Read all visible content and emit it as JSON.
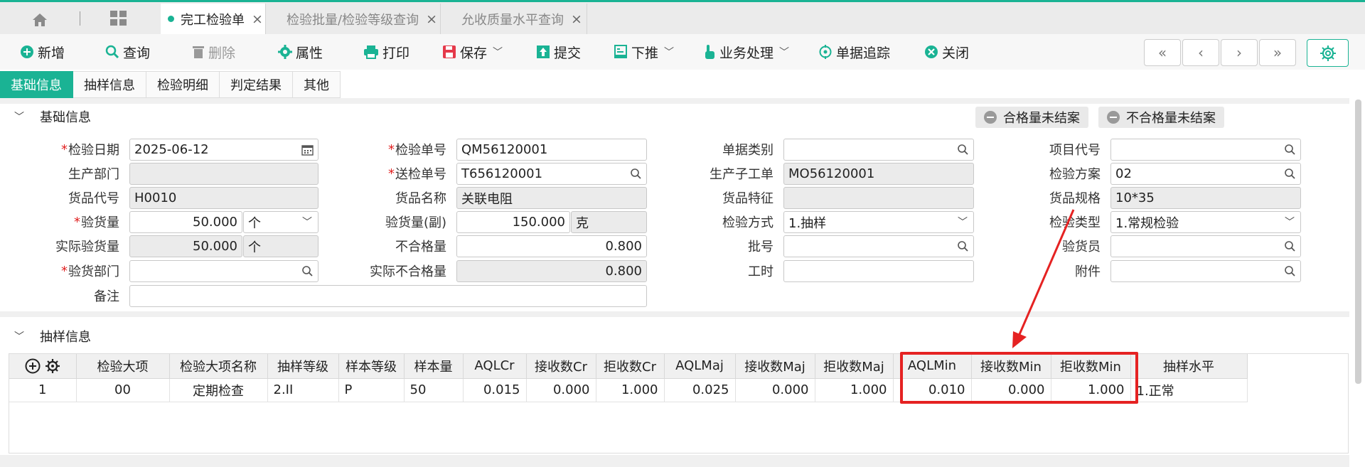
{
  "tabs": [
    {
      "label": "完工检验单",
      "close": "×"
    },
    {
      "label": "检验批量/检验等级查询",
      "close": "×"
    },
    {
      "label": "允收质量水平查询",
      "close": "×"
    }
  ],
  "toolbar": {
    "new": "新增",
    "query": "查询",
    "delete": "删除",
    "properties": "属性",
    "print": "打印",
    "save": "保存",
    "submit": "提交",
    "push_down": "下推",
    "business": "业务处理",
    "trace": "单据追踪",
    "close": "关闭"
  },
  "subtabs": [
    "基础信息",
    "抽样信息",
    "检验明细",
    "判定结果",
    "其他"
  ],
  "section_basic": {
    "title": "基础信息",
    "badge_pass": "合格量未结案",
    "badge_fail": "不合格量未结案"
  },
  "form": {
    "inspect_date": {
      "label": "检验日期",
      "value": "2025-06-12"
    },
    "prod_dept": {
      "label": "生产部门",
      "value": ""
    },
    "item_code": {
      "label": "货品代号",
      "value": "H0010"
    },
    "inspect_qty": {
      "label": "验货量",
      "value": "50.000",
      "unit": "个"
    },
    "actual_qty": {
      "label": "实际验货量",
      "value": "50.000",
      "unit": "个"
    },
    "inspect_dept": {
      "label": "验货部门",
      "value": ""
    },
    "remark": {
      "label": "备注",
      "value": ""
    },
    "inspect_no": {
      "label": "检验单号",
      "value": "QM56120001"
    },
    "send_no": {
      "label": "送检单号",
      "value": "T656120001"
    },
    "item_name": {
      "label": "货品名称",
      "value": "关联电阻"
    },
    "inspect_qty2": {
      "label": "验货量(副)",
      "value": "150.000",
      "unit": "克"
    },
    "ng_qty": {
      "label": "不合格量",
      "value": "0.800"
    },
    "actual_ng": {
      "label": "实际不合格量",
      "value": "0.800"
    },
    "doc_type": {
      "label": "单据类别",
      "value": ""
    },
    "sub_order": {
      "label": "生产子工单",
      "value": "MO56120001"
    },
    "item_feature": {
      "label": "货品特征",
      "value": ""
    },
    "method": {
      "label": "检验方式",
      "value": "1.抽样"
    },
    "batch": {
      "label": "批号",
      "value": ""
    },
    "hours": {
      "label": "工时",
      "value": ""
    },
    "project": {
      "label": "项目代号",
      "value": ""
    },
    "plan": {
      "label": "检验方案",
      "value": "02"
    },
    "spec": {
      "label": "货品规格",
      "value": "10*35"
    },
    "type": {
      "label": "检验类型",
      "value": "1.常规检验"
    },
    "inspector": {
      "label": "验货员",
      "value": ""
    },
    "attach": {
      "label": "附件",
      "value": ""
    }
  },
  "section_sampling": {
    "title": "抽样信息"
  },
  "grid": {
    "headers": [
      "检验大项",
      "检验大项名称",
      "抽样等级",
      "样本等级",
      "样本量",
      "AQLCr",
      "接收数Cr",
      "拒收数Cr",
      "AQLMaj",
      "接收数Maj",
      "拒收数Maj",
      "AQLMin",
      "接收数Min",
      "拒收数Min",
      "抽样水平"
    ],
    "rows": [
      [
        "1",
        "00",
        "定期检查",
        "2.II",
        "P",
        "50",
        "0.015",
        "0.000",
        "1.000",
        "0.025",
        "0.000",
        "1.000",
        "0.010",
        "0.000",
        "1.000",
        "1.正常"
      ]
    ]
  },
  "colors": {
    "accent": "#1ab394",
    "highlight": "#e52222"
  }
}
